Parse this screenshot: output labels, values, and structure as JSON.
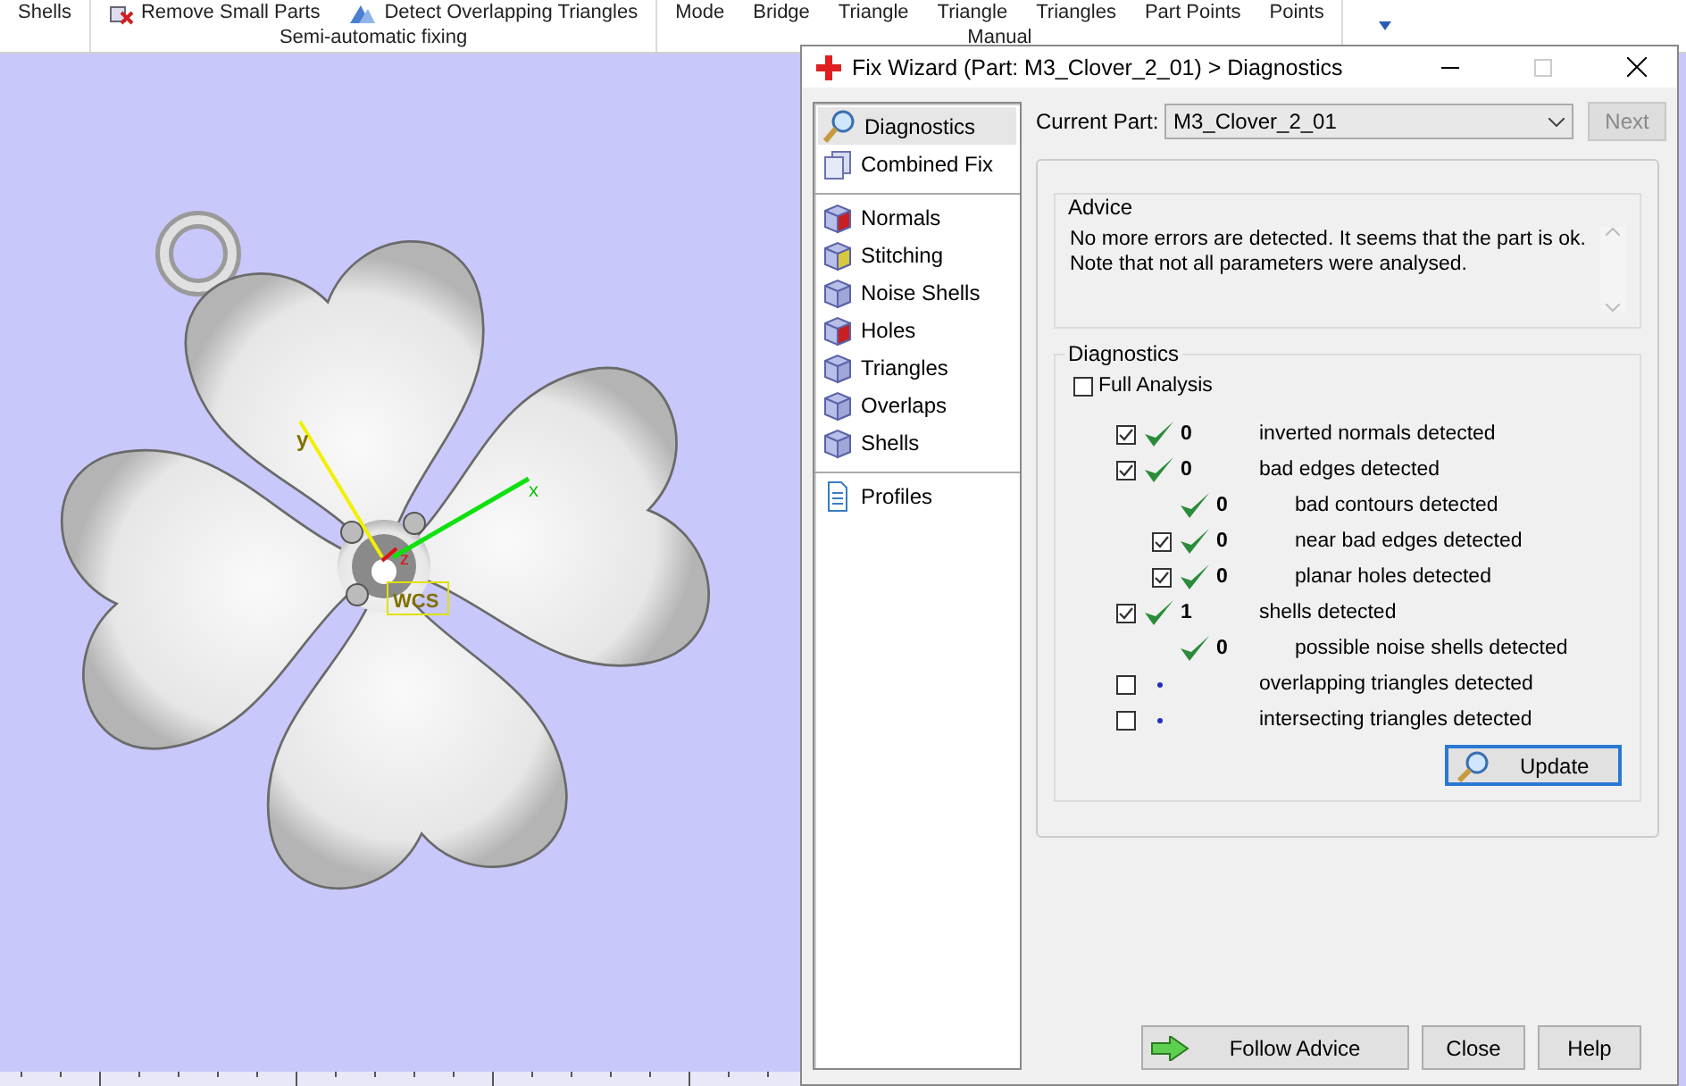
{
  "ribbon": {
    "groups": [
      {
        "buttons": [
          "Shells"
        ]
      },
      {
        "buttons": [
          "Remove Small Parts",
          "Detect Overlapping Triangles"
        ],
        "label": "Semi-automatic fixing"
      },
      {
        "buttons": [
          "Mode",
          "Bridge",
          "Triangle",
          "Triangle",
          "Triangles",
          "Part Points",
          "Points"
        ],
        "label": "Manual"
      }
    ]
  },
  "viewport": {
    "axis_labels": [
      "x",
      "y",
      "z"
    ],
    "tag": "WCS"
  },
  "dialog": {
    "title": "Fix Wizard (Part: M3_Clover_2_01) > Diagnostics",
    "navigation": [
      [
        {
          "label": "Diagnostics",
          "selected": true
        },
        {
          "label": "Combined Fix",
          "selected": false
        }
      ],
      [
        {
          "label": "Normals",
          "selected": false
        },
        {
          "label": "Stitching",
          "selected": false
        },
        {
          "label": "Noise Shells",
          "selected": false
        },
        {
          "label": "Holes",
          "selected": false
        },
        {
          "label": "Triangles",
          "selected": false
        },
        {
          "label": "Overlaps",
          "selected": false
        },
        {
          "label": "Shells",
          "selected": false
        }
      ],
      [
        {
          "label": "Profiles",
          "selected": false
        }
      ]
    ],
    "current_part": {
      "label": "Current Part:",
      "value": "M3_Clover_2_01"
    },
    "next_button": {
      "label": "Next",
      "disabled": true
    },
    "advice": {
      "title": "Advice",
      "text": "No more errors are detected. It seems that the part is ok.\nNote that not all parameters were analysed."
    },
    "diagnostics": {
      "title": "Diagnostics",
      "full_analysis": {
        "label": "Full Analysis",
        "checked": false
      },
      "rows": [
        {
          "kind": "checkbox",
          "checked": true,
          "passed": true,
          "count": "0",
          "label": "inverted normals detected"
        },
        {
          "kind": "checkbox",
          "checked": true,
          "passed": true,
          "count": "0",
          "label": "bad edges detected",
          "children": [
            {
              "kind": "plain",
              "passed": true,
              "count": "0",
              "label": "bad contours detected"
            },
            {
              "kind": "checkbox",
              "checked": true,
              "passed": true,
              "count": "0",
              "label": "near bad edges detected"
            },
            {
              "kind": "checkbox",
              "checked": true,
              "passed": true,
              "count": "0",
              "label": "planar holes detected"
            }
          ]
        },
        {
          "kind": "checkbox",
          "checked": true,
          "passed": true,
          "count": "1",
          "label": "shells detected",
          "children": [
            {
              "kind": "plain",
              "passed": true,
              "count": "0",
              "label": "possible noise shells detected"
            }
          ]
        },
        {
          "kind": "checkbox",
          "checked": false,
          "passed": false,
          "label": "overlapping triangles detected"
        },
        {
          "kind": "checkbox",
          "checked": false,
          "passed": false,
          "label": "intersecting triangles detected"
        }
      ],
      "update_button": "Update"
    },
    "buttons": [
      {
        "kind": "follow",
        "label": "Follow Advice"
      },
      {
        "kind": "plain",
        "label": "Close"
      },
      {
        "kind": "plain",
        "label": "Help"
      }
    ]
  }
}
